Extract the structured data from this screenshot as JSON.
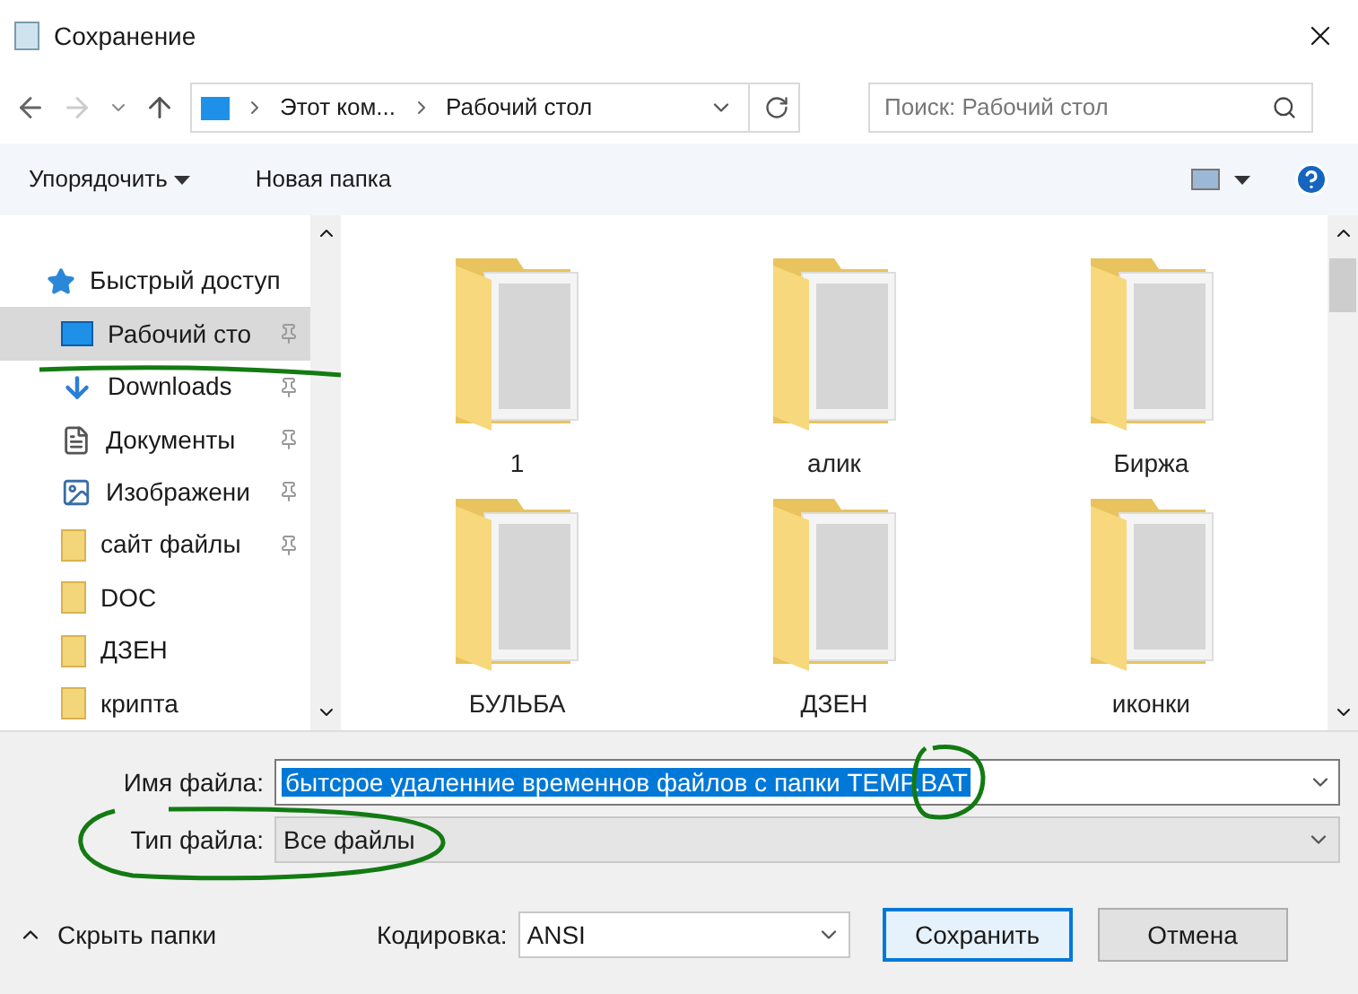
{
  "window": {
    "title": "Сохранение"
  },
  "nav": {
    "path": [
      "Этот ком...",
      "Рабочий стол"
    ],
    "search": {
      "placeholder": "Поиск: Рабочий стол"
    }
  },
  "toolbar": {
    "organize": "Упорядочить",
    "new_folder": "Новая папка"
  },
  "sidebar": {
    "items": [
      {
        "kind": "quick",
        "label": "Быстрый доступ",
        "selected": false,
        "pinned": false
      },
      {
        "kind": "desktop",
        "label": "Рабочий сто",
        "selected": true,
        "pinned": true
      },
      {
        "kind": "downloads",
        "label": "Downloads",
        "selected": false,
        "pinned": true
      },
      {
        "kind": "documents",
        "label": "Документы",
        "selected": false,
        "pinned": true
      },
      {
        "kind": "pictures",
        "label": "Изображени",
        "selected": false,
        "pinned": true
      },
      {
        "kind": "folder",
        "label": "сайт файлы",
        "selected": false,
        "pinned": true
      },
      {
        "kind": "folder",
        "label": "DOC",
        "selected": false,
        "pinned": false
      },
      {
        "kind": "folder",
        "label": "ДЗЕН",
        "selected": false,
        "pinned": false
      },
      {
        "kind": "folder",
        "label": "крипта",
        "selected": false,
        "pinned": false
      }
    ]
  },
  "files": [
    {
      "name": "1"
    },
    {
      "name": "алик"
    },
    {
      "name": "Биржа"
    },
    {
      "name": "БУЛЬБА"
    },
    {
      "name": "ДЗЕН"
    },
    {
      "name": "иконки"
    }
  ],
  "form": {
    "filename_label": "Имя файла:",
    "filename": "бытсрое удаленние временнов файлов с папки TEMP.BAT",
    "filename_selected": true,
    "type_label": "Тип файла:",
    "type": "Все файлы",
    "encoding_label": "Кодировка:",
    "encoding": "ANSI"
  },
  "footer": {
    "hide_folders": "Скрыть папки",
    "save": "Сохранить",
    "cancel": "Отмена"
  }
}
